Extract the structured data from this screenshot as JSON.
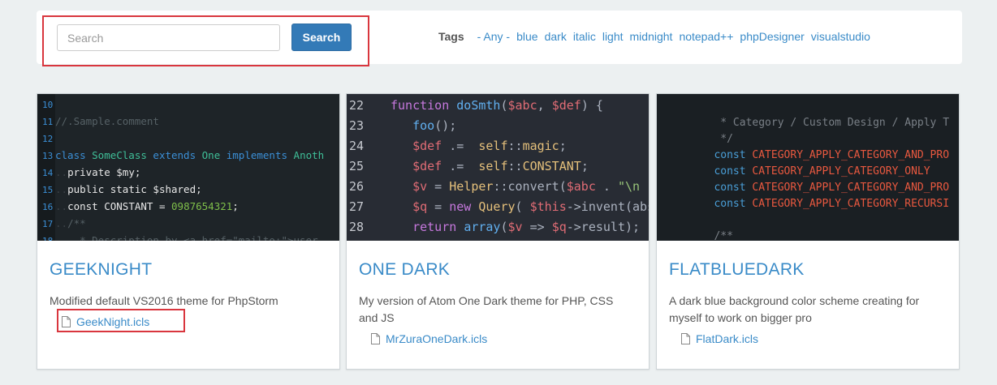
{
  "search": {
    "placeholder": "Search",
    "button_label": "Search"
  },
  "tags": {
    "label": "Tags",
    "items": [
      "- Any -",
      "blue",
      "dark",
      "italic",
      "light",
      "midnight",
      "notepad++",
      "phpDesigner",
      "visualstudio"
    ]
  },
  "cards": [
    {
      "title": "GEEKNIGHT",
      "description": "Modified default VS2016 theme for PhpStorm",
      "file": "GeekNight.icls",
      "code": [
        {
          "n": "10",
          "segs": []
        },
        {
          "n": "11",
          "segs": [
            [
              "//.Sample.comment",
              "#566166"
            ]
          ]
        },
        {
          "n": "12",
          "segs": []
        },
        {
          "n": "13",
          "segs": [
            [
              "class ",
              "#3b8fd6"
            ],
            [
              "SomeClass ",
              "#3fbf98"
            ],
            [
              "extends ",
              "#3b8fd6"
            ],
            [
              "One ",
              "#3fbf98"
            ],
            [
              "implements ",
              "#3b8fd6"
            ],
            [
              "Anoth",
              "#3fbf98"
            ]
          ]
        },
        {
          "n": "14",
          "segs": [
            [
              "..",
              "#3a4146"
            ],
            [
              "private ",
              "#e8e8e8"
            ],
            [
              "$my;",
              "#e8e8e8"
            ]
          ]
        },
        {
          "n": "15",
          "segs": [
            [
              "..",
              "#3a4146"
            ],
            [
              "public static ",
              "#e8e8e8"
            ],
            [
              "$shared;",
              "#e8e8e8"
            ]
          ]
        },
        {
          "n": "16",
          "segs": [
            [
              "..",
              "#3a4146"
            ],
            [
              "const ",
              "#e8e8e8"
            ],
            [
              "CONSTANT = ",
              "#e8e8e8"
            ],
            [
              "0987654321",
              "#7fbf4a"
            ],
            [
              ";",
              "#e8e8e8"
            ]
          ]
        },
        {
          "n": "17",
          "segs": [
            [
              "..",
              "#3a4146"
            ],
            [
              "/**",
              "#566166"
            ]
          ]
        },
        {
          "n": "18",
          "segs": [
            [
              "....* Description by <a href=\"mailto:\">user",
              "#566166"
            ]
          ]
        }
      ]
    },
    {
      "title": "ONE DARK",
      "description": "My version of Atom One Dark theme for PHP, CSS and JS",
      "file": "MrZuraOneDark.icls",
      "code": [
        {
          "n": "22",
          "segs": [
            [
              "function ",
              "#c678dd"
            ],
            [
              "doSmth",
              "#61afef"
            ],
            [
              "(",
              "#abb2bf"
            ],
            [
              "$abc",
              "#e06c75"
            ],
            [
              ", ",
              "#abb2bf"
            ],
            [
              "$def",
              "#e06c75"
            ],
            [
              ") {",
              "#abb2bf"
            ]
          ]
        },
        {
          "n": "23",
          "segs": [
            [
              "   ",
              "#abb2bf"
            ],
            [
              "foo",
              "#61afef"
            ],
            [
              "();",
              "#abb2bf"
            ]
          ]
        },
        {
          "n": "24",
          "segs": [
            [
              "   ",
              "#abb2bf"
            ],
            [
              "$def",
              "#e06c75"
            ],
            [
              " .=  ",
              "#abb2bf"
            ],
            [
              "self",
              "#e5c07b"
            ],
            [
              "::",
              "#abb2bf"
            ],
            [
              "magic",
              "#e5c07b"
            ],
            [
              ";",
              "#abb2bf"
            ]
          ]
        },
        {
          "n": "25",
          "segs": [
            [
              "   ",
              "#abb2bf"
            ],
            [
              "$def",
              "#e06c75"
            ],
            [
              " .=  ",
              "#abb2bf"
            ],
            [
              "self",
              "#e5c07b"
            ],
            [
              "::",
              "#abb2bf"
            ],
            [
              "CONSTANT",
              "#e5c07b"
            ],
            [
              ";",
              "#abb2bf"
            ]
          ]
        },
        {
          "n": "26",
          "segs": [
            [
              "   ",
              "#abb2bf"
            ],
            [
              "$v",
              "#e06c75"
            ],
            [
              " = ",
              "#abb2bf"
            ],
            [
              "Helper",
              "#e5c07b"
            ],
            [
              "::",
              "#abb2bf"
            ],
            [
              "convert",
              "#abb2bf"
            ],
            [
              "(",
              "#abb2bf"
            ],
            [
              "$abc",
              "#e06c75"
            ],
            [
              " . ",
              "#abb2bf"
            ],
            [
              "\"\\n ",
              "#98c379"
            ]
          ]
        },
        {
          "n": "27",
          "segs": [
            [
              "   ",
              "#abb2bf"
            ],
            [
              "$q",
              "#e06c75"
            ],
            [
              " = ",
              "#abb2bf"
            ],
            [
              "new ",
              "#c678dd"
            ],
            [
              "Query",
              "#e5c07b"
            ],
            [
              "( ",
              "#abb2bf"
            ],
            [
              "$this",
              "#e06c75"
            ],
            [
              "->invent(abs",
              "#abb2bf"
            ]
          ]
        },
        {
          "n": "28",
          "segs": [
            [
              "   ",
              "#abb2bf"
            ],
            [
              "return ",
              "#c678dd"
            ],
            [
              "array",
              "#61afef"
            ],
            [
              "(",
              "#abb2bf"
            ],
            [
              "$v",
              "#e06c75"
            ],
            [
              " => ",
              "#abb2bf"
            ],
            [
              "$q",
              "#e06c75"
            ],
            [
              "->result);",
              "#abb2bf"
            ]
          ]
        }
      ]
    },
    {
      "title": "FLATBLUEDARK",
      "description": "A dark blue background color scheme creating for myself to work on bigger pro",
      "file": "FlatDark.icls",
      "code": [
        {
          "segs": []
        },
        {
          "segs": [
            [
              "          * Category / Custom Design / Apply T",
              "#7a8087"
            ]
          ]
        },
        {
          "segs": [
            [
              "          */",
              "#7a8087"
            ]
          ]
        },
        {
          "segs": [
            [
              "         const ",
              "#4a9fd8"
            ],
            [
              "CATEGORY_APPLY_CATEGORY_AND_PRO",
              "#e8583f"
            ]
          ]
        },
        {
          "segs": [
            [
              "         const ",
              "#4a9fd8"
            ],
            [
              "CATEGORY_APPLY_CATEGORY_ONLY",
              "#e8583f"
            ]
          ]
        },
        {
          "segs": [
            [
              "         const ",
              "#4a9fd8"
            ],
            [
              "CATEGORY_APPLY_CATEGORY_AND_PRO",
              "#e8583f"
            ]
          ]
        },
        {
          "segs": [
            [
              "         const ",
              "#4a9fd8"
            ],
            [
              "CATEGORY_APPLY_CATEGORY_RECURSI",
              "#e8583f"
            ]
          ]
        },
        {
          "segs": []
        },
        {
          "segs": [
            [
              "         /**",
              "#7a8087"
            ]
          ]
        }
      ]
    }
  ]
}
